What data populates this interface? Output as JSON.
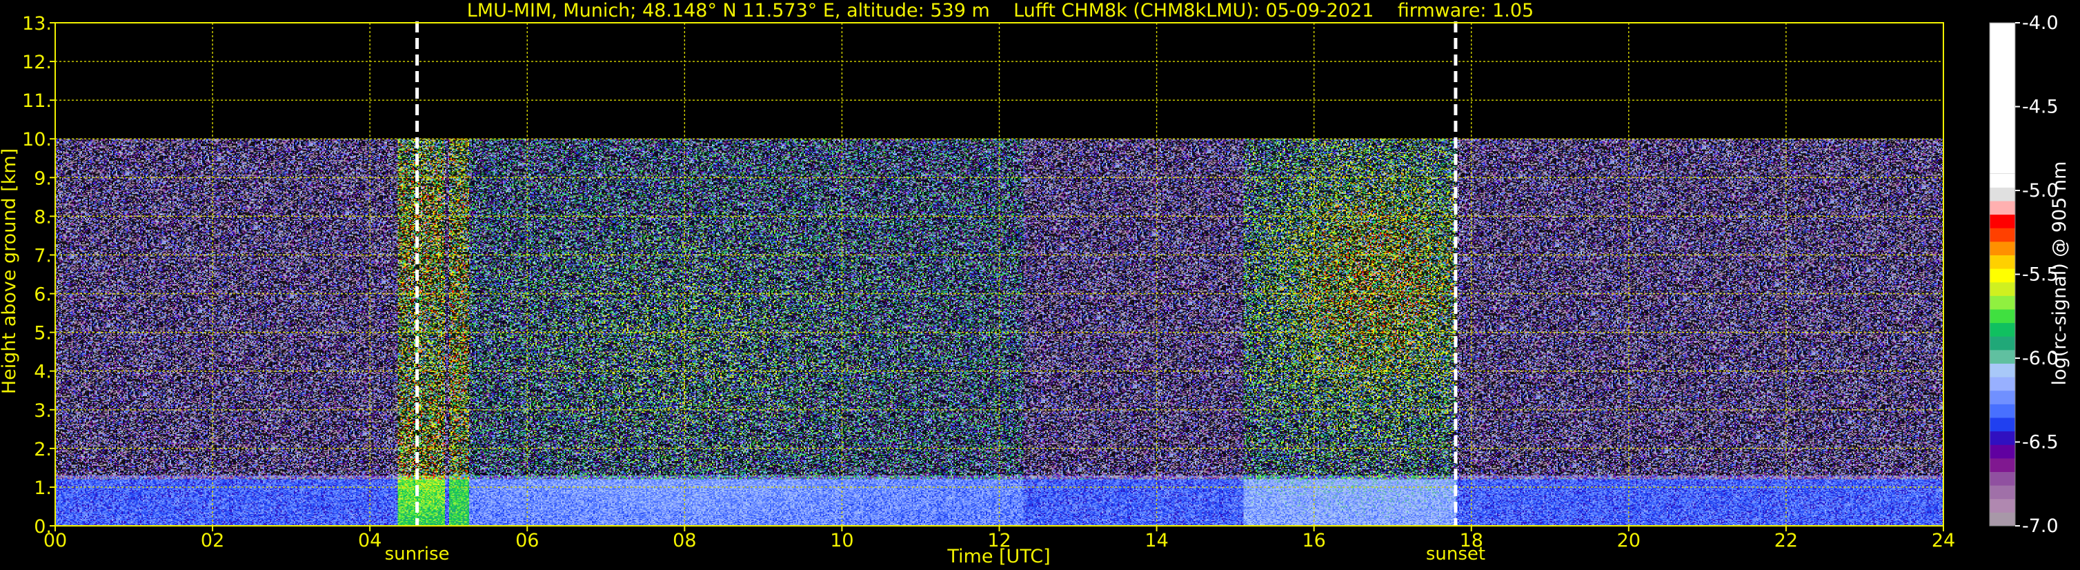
{
  "chart_data": {
    "type": "heatmap",
    "title": "LMU-MIM, Munich; 48.148° N 11.573° E, altitude: 539 m    Lufft CHM8k (CHM8kLMU): 05-09-2021    firmware: 1.05",
    "xlabel": "Time [UTC]",
    "ylabel": "Height above ground [km]",
    "xlim": [
      0,
      24
    ],
    "ylim": [
      0,
      13
    ],
    "x_ticks": [
      "00",
      "02",
      "04",
      "06",
      "08",
      "10",
      "12",
      "14",
      "16",
      "18",
      "20",
      "22",
      "24"
    ],
    "y_ticks": [
      "0.",
      "1.",
      "2.",
      "3.",
      "4.",
      "5.",
      "6.",
      "7.",
      "8.",
      "9.",
      "10.",
      "11.",
      "12.",
      "13."
    ],
    "grid": true,
    "max_height_km": 10,
    "colorbar": {
      "label": "log(rc-signal) @ 905 nm",
      "range": [
        -7.0,
        -4.0
      ],
      "ticks": [
        "-4.0",
        "-4.5",
        "-5.0",
        "-5.5",
        "-6.0",
        "-6.5",
        "-7.0"
      ],
      "colors": [
        "#a898a8",
        "#b088b0",
        "#a070a8",
        "#9050a0",
        "#801890",
        "#6000a0",
        "#3010c0",
        "#2040f0",
        "#4870ff",
        "#7090ff",
        "#98b0ff",
        "#a8c8f8",
        "#60c0a0",
        "#20a878",
        "#10c060",
        "#40e040",
        "#90f040",
        "#d0f020",
        "#ffff00",
        "#ffd000",
        "#ff9000",
        "#ff4000",
        "#ff0000",
        "#ffb0b0",
        "#e0e0e0",
        "#ffffff"
      ]
    },
    "markers": [
      {
        "label": "sunrise",
        "time_h": 4.6
      },
      {
        "label": "sunset",
        "time_h": 17.8
      }
    ]
  }
}
